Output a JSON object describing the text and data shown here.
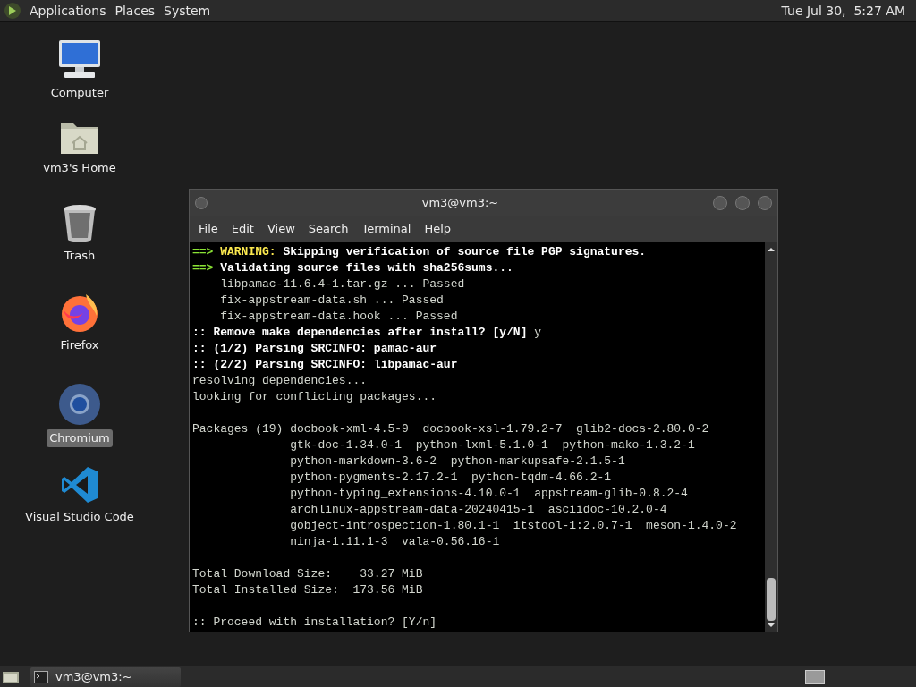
{
  "top_panel": {
    "menus": [
      "Applications",
      "Places",
      "System"
    ],
    "clock": "Tue Jul 30,  5:27 AM"
  },
  "desktop_icons": [
    {
      "kind": "computer",
      "label": "Computer",
      "selected": false
    },
    {
      "kind": "home",
      "label": "vm3's Home",
      "selected": false
    },
    {
      "kind": "trash",
      "label": "Trash",
      "selected": false
    },
    {
      "kind": "firefox",
      "label": "Firefox",
      "selected": false
    },
    {
      "kind": "chromium",
      "label": "Chromium",
      "selected": true
    },
    {
      "kind": "vscode",
      "label": "Visual Studio Code",
      "selected": false
    }
  ],
  "terminal": {
    "title": "vm3@vm3:~",
    "menu": [
      "File",
      "Edit",
      "View",
      "Search",
      "Terminal",
      "Help"
    ],
    "lines": [
      {
        "kind": "text",
        "segments": [
          {
            "kind": "arrow",
            "text": "==> "
          },
          {
            "kind": "warning",
            "text": "WARNING:"
          },
          {
            "kind": "bold",
            "text": " Skipping verification of source file PGP signatures."
          }
        ]
      },
      {
        "kind": "text",
        "segments": [
          {
            "kind": "arrow",
            "text": "==> "
          },
          {
            "kind": "bold",
            "text": "Validating source files with sha256sums..."
          }
        ]
      },
      {
        "kind": "text",
        "segments": [
          {
            "kind": "plain",
            "text": "    libpamac-11.6.4-1.tar.gz ... Passed"
          }
        ]
      },
      {
        "kind": "text",
        "segments": [
          {
            "kind": "plain",
            "text": "    fix-appstream-data.sh ... Passed"
          }
        ]
      },
      {
        "kind": "text",
        "segments": [
          {
            "kind": "plain",
            "text": "    fix-appstream-data.hook ... Passed"
          }
        ]
      },
      {
        "kind": "text",
        "segments": [
          {
            "kind": "bold",
            "text": ":: Remove make dependencies after install? [y/N]"
          },
          {
            "kind": "plain",
            "text": " y"
          }
        ]
      },
      {
        "kind": "text",
        "segments": [
          {
            "kind": "bold",
            "text": ":: (1/2) Parsing SRCINFO: pamac-aur"
          }
        ]
      },
      {
        "kind": "text",
        "segments": [
          {
            "kind": "bold",
            "text": ":: (2/2) Parsing SRCINFO: libpamac-aur"
          }
        ]
      },
      {
        "kind": "text",
        "segments": [
          {
            "kind": "plain",
            "text": "resolving dependencies..."
          }
        ]
      },
      {
        "kind": "text",
        "segments": [
          {
            "kind": "plain",
            "text": "looking for conflicting packages..."
          }
        ]
      },
      {
        "kind": "blank"
      },
      {
        "kind": "text",
        "segments": [
          {
            "kind": "plain",
            "text": "Packages (19) docbook-xml-4.5-9  docbook-xsl-1.79.2-7  glib2-docs-2.80.0-2"
          }
        ]
      },
      {
        "kind": "text",
        "segments": [
          {
            "kind": "plain",
            "text": "              gtk-doc-1.34.0-1  python-lxml-5.1.0-1  python-mako-1.3.2-1"
          }
        ]
      },
      {
        "kind": "text",
        "segments": [
          {
            "kind": "plain",
            "text": "              python-markdown-3.6-2  python-markupsafe-2.1.5-1"
          }
        ]
      },
      {
        "kind": "text",
        "segments": [
          {
            "kind": "plain",
            "text": "              python-pygments-2.17.2-1  python-tqdm-4.66.2-1"
          }
        ]
      },
      {
        "kind": "text",
        "segments": [
          {
            "kind": "plain",
            "text": "              python-typing_extensions-4.10.0-1  appstream-glib-0.8.2-4"
          }
        ]
      },
      {
        "kind": "text",
        "segments": [
          {
            "kind": "plain",
            "text": "              archlinux-appstream-data-20240415-1  asciidoc-10.2.0-4"
          }
        ]
      },
      {
        "kind": "text",
        "segments": [
          {
            "kind": "plain",
            "text": "              gobject-introspection-1.80.1-1  itstool-1:2.0.7-1  meson-1.4.0-2"
          }
        ]
      },
      {
        "kind": "text",
        "segments": [
          {
            "kind": "plain",
            "text": "              ninja-1.11.1-3  vala-0.56.16-1"
          }
        ]
      },
      {
        "kind": "blank"
      },
      {
        "kind": "text",
        "segments": [
          {
            "kind": "plain",
            "text": "Total Download Size:    33.27 MiB"
          }
        ]
      },
      {
        "kind": "text",
        "segments": [
          {
            "kind": "plain",
            "text": "Total Installed Size:  173.56 MiB"
          }
        ]
      },
      {
        "kind": "blank"
      },
      {
        "kind": "text",
        "segments": [
          {
            "kind": "plain",
            "text": ":: Proceed with installation? [Y/n]"
          }
        ]
      }
    ]
  },
  "taskbar": {
    "tasks": [
      {
        "label": "vm3@vm3:~",
        "selected": false
      }
    ]
  }
}
